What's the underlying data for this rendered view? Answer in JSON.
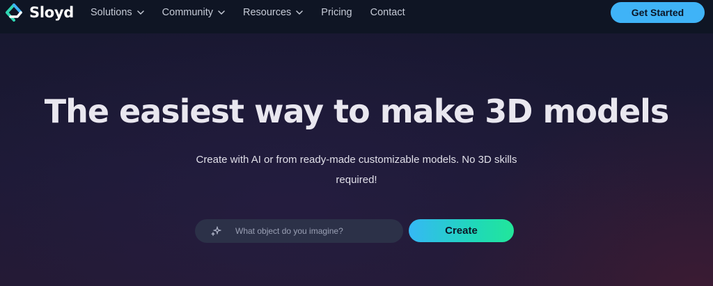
{
  "brand": {
    "name": "Sloyd",
    "logo_icon": "sloyd-logo-icon"
  },
  "nav": {
    "items": [
      {
        "label": "Solutions",
        "has_dropdown": true
      },
      {
        "label": "Community",
        "has_dropdown": true
      },
      {
        "label": "Resources",
        "has_dropdown": true
      },
      {
        "label": "Pricing",
        "has_dropdown": false
      },
      {
        "label": "Contact",
        "has_dropdown": false
      }
    ],
    "cta_label": "Get Started"
  },
  "hero": {
    "headline": "The easiest way to make 3D models",
    "subtitle": "Create with AI or from ready-made customizable models. No 3D skills required!",
    "search": {
      "placeholder": "What object do you imagine?",
      "value": "",
      "icon": "sparkle-icon"
    },
    "create_label": "Create"
  },
  "colors": {
    "nav_background": "#0f1524",
    "cta": "#3fb3f7",
    "create_gradient_start": "#35b8f5",
    "create_gradient_end": "#22e69a",
    "logo_accent": "#2fd6b2"
  }
}
